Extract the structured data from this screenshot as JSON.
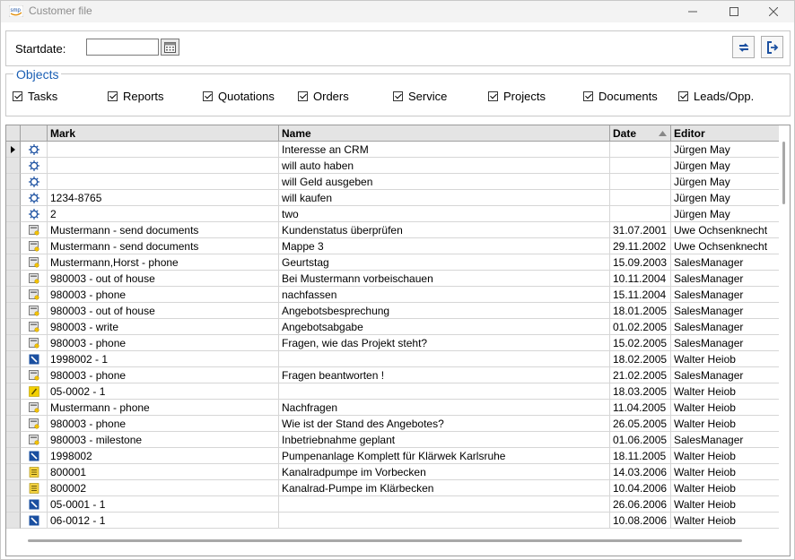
{
  "window": {
    "title": "Customer file",
    "logo_text": "smp"
  },
  "toolbar": {
    "startdate_label": "Startdate:",
    "startdate_value": ""
  },
  "objects": {
    "legend": "Objects",
    "checkboxes": [
      {
        "label": "Tasks",
        "checked": true
      },
      {
        "label": "Reports",
        "checked": true
      },
      {
        "label": "Quotations",
        "checked": true
      },
      {
        "label": "Orders",
        "checked": true
      },
      {
        "label": "Service",
        "checked": true
      },
      {
        "label": "Projects",
        "checked": true
      },
      {
        "label": "Documents",
        "checked": true
      },
      {
        "label": "Leads/Opp.",
        "checked": true
      }
    ]
  },
  "grid": {
    "headers": {
      "mark": "Mark",
      "name": "Name",
      "date": "Date",
      "editor": "Editor"
    },
    "sort_column": "date",
    "rows": [
      {
        "icon": "lead-icon",
        "mark": "",
        "name": "Interesse an CRM",
        "date": "",
        "editor": "Jürgen May"
      },
      {
        "icon": "lead-icon",
        "mark": "",
        "name": "will auto haben",
        "date": "",
        "editor": "Jürgen May"
      },
      {
        "icon": "lead-icon",
        "mark": "",
        "name": "will Geld ausgeben",
        "date": "",
        "editor": "Jürgen May"
      },
      {
        "icon": "lead-icon",
        "mark": "1234-8765",
        "name": "will kaufen",
        "date": "",
        "editor": "Jürgen May"
      },
      {
        "icon": "lead-icon",
        "mark": "2",
        "name": "two",
        "date": "",
        "editor": "Jürgen May"
      },
      {
        "icon": "task-icon",
        "mark": "Mustermann - send documents",
        "name": "Kundenstatus überprüfen",
        "date": "31.07.2001",
        "editor": "Uwe Ochsenknecht"
      },
      {
        "icon": "task-icon",
        "mark": "Mustermann - send documents",
        "name": "Mappe 3",
        "date": "29.11.2002",
        "editor": "Uwe Ochsenknecht"
      },
      {
        "icon": "task-icon",
        "mark": "Mustermann,Horst - phone",
        "name": "Geurtstag",
        "date": "15.09.2003",
        "editor": "SalesManager"
      },
      {
        "icon": "task-icon",
        "mark": "980003 - out of house",
        "name": "Bei Mustermann vorbeischauen",
        "date": "10.11.2004",
        "editor": "SalesManager"
      },
      {
        "icon": "task-icon",
        "mark": "980003 - phone",
        "name": "nachfassen",
        "date": "15.11.2004",
        "editor": "SalesManager"
      },
      {
        "icon": "task-icon",
        "mark": "980003 - out of house",
        "name": "Angebotsbesprechung",
        "date": "18.01.2005",
        "editor": "SalesManager"
      },
      {
        "icon": "task-icon",
        "mark": "980003 - write",
        "name": "Angebotsabgabe",
        "date": "01.02.2005",
        "editor": "SalesManager"
      },
      {
        "icon": "task-icon",
        "mark": "980003 - phone",
        "name": "Fragen, wie das Projekt steht?",
        "date": "15.02.2005",
        "editor": "SalesManager"
      },
      {
        "icon": "project-icon",
        "mark": "1998002 - 1",
        "name": "",
        "date": "18.02.2005",
        "editor": "Walter Heiob"
      },
      {
        "icon": "task-icon",
        "mark": "980003 - phone",
        "name": "Fragen beantworten !",
        "date": "21.02.2005",
        "editor": "SalesManager"
      },
      {
        "icon": "report-icon",
        "mark": "05-0002 - 1",
        "name": "",
        "date": "18.03.2005",
        "editor": "Walter Heiob"
      },
      {
        "icon": "task-icon",
        "mark": "Mustermann - phone",
        "name": "Nachfragen",
        "date": "11.04.2005",
        "editor": "Walter Heiob"
      },
      {
        "icon": "task-icon",
        "mark": "980003 - phone",
        "name": "Wie ist der Stand des Angebotes?",
        "date": "26.05.2005",
        "editor": "Walter Heiob"
      },
      {
        "icon": "task-icon",
        "mark": "980003 - milestone",
        "name": "Inbetriebnahme geplant",
        "date": "01.06.2005",
        "editor": "SalesManager"
      },
      {
        "icon": "project-icon",
        "mark": "1998002",
        "name": "Pumpenanlage Komplett für Klärwek Karlsruhe",
        "date": "18.11.2005",
        "editor": "Walter Heiob"
      },
      {
        "icon": "quotation-icon",
        "mark": "800001",
        "name": "Kanalradpumpe im Vorbecken",
        "date": "14.03.2006",
        "editor": "Walter Heiob"
      },
      {
        "icon": "quotation-icon",
        "mark": "800002",
        "name": "Kanalrad-Pumpe im Klärbecken",
        "date": "10.04.2006",
        "editor": "Walter Heiob"
      },
      {
        "icon": "project-icon",
        "mark": "05-0001 - 1",
        "name": "",
        "date": "26.06.2006",
        "editor": "Walter Heiob"
      },
      {
        "icon": "project-icon",
        "mark": "06-0012 - 1",
        "name": "",
        "date": "10.08.2006",
        "editor": "Walter Heiob"
      }
    ]
  }
}
